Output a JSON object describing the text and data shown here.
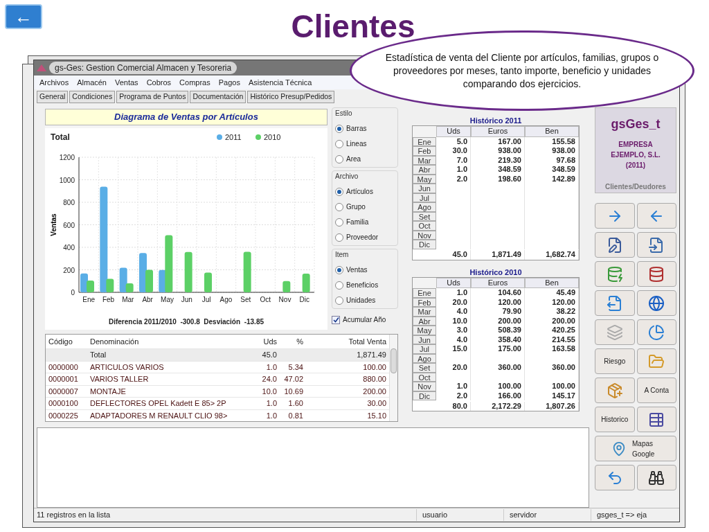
{
  "slide": {
    "back_button": "←",
    "title": "Clientes",
    "callout": "Estadística de venta del Cliente  por artículos, familias, grupos o proveedores por meses, tanto importe, beneficio y unidades comparando dos ejercicios."
  },
  "window": {
    "title": "gs-Ges: Gestion Comercial Almacen y Tesoreria"
  },
  "menu": [
    "Archivos",
    "Almacén",
    "Ventas",
    "Cobros",
    "Compras",
    "Pagos",
    "Asistencia Técnica"
  ],
  "tabs": [
    {
      "label": "General",
      "selected": false
    },
    {
      "label": "Condiciones",
      "selected": false
    },
    {
      "label": "Programa de Puntos",
      "selected": false
    },
    {
      "label": "Documentación",
      "selected": false
    },
    {
      "label": "Histórico Presup/Pedidos",
      "selected": false
    }
  ],
  "chart_panel": {
    "heading": "Diagrama de Ventas por Artículos",
    "summary": "Diferencia 2011/2010  -300.8  Desviación  -13.85",
    "chart_data": {
      "type": "bar",
      "grid": true,
      "title": "Total",
      "ylabel": "Ventas",
      "categories": [
        "Ene",
        "Feb",
        "Mar",
        "Abr",
        "May",
        "Jun",
        "Jul",
        "Ago",
        "Set",
        "Oct",
        "Nov",
        "Dic"
      ],
      "ylim": [
        0,
        1200
      ],
      "yticks": [
        0,
        200,
        400,
        600,
        800,
        1000,
        1200
      ],
      "series": [
        {
          "name": "2011",
          "color": "#5aaee6",
          "values": [
            167,
            938,
            219,
            349,
            199,
            0,
            0,
            0,
            0,
            0,
            0,
            0
          ]
        },
        {
          "name": "2010",
          "color": "#5cd066",
          "values": [
            105,
            120,
            80,
            200,
            508,
            358,
            175,
            0,
            360,
            0,
            100,
            166
          ]
        }
      ]
    }
  },
  "options": {
    "groups": [
      {
        "title": "Estilo",
        "items": [
          {
            "label": "Barras",
            "selected": true
          },
          {
            "label": "Lineas",
            "selected": false
          },
          {
            "label": "Area",
            "selected": false
          }
        ]
      },
      {
        "title": "Archivo",
        "items": [
          {
            "label": "Artículos",
            "selected": true
          },
          {
            "label": "Grupo",
            "selected": false
          },
          {
            "label": "Familia",
            "selected": false
          },
          {
            "label": "Proveedor",
            "selected": false
          }
        ]
      },
      {
        "title": "Item",
        "items": [
          {
            "label": "Ventas",
            "selected": true
          },
          {
            "label": "Beneficios",
            "selected": false
          },
          {
            "label": "Unidades",
            "selected": false
          }
        ]
      }
    ],
    "accumulate": {
      "label": "Acumular Año",
      "checked": true
    }
  },
  "history_tables": [
    {
      "title": "Histórico 2011",
      "columns": [
        "Uds",
        "Euros",
        "Ben"
      ],
      "rows": [
        {
          "month": "Ene",
          "uds": "5.0",
          "euros": "167.00",
          "ben": "155.58"
        },
        {
          "month": "Feb",
          "uds": "30.0",
          "euros": "938.00",
          "ben": "938.00"
        },
        {
          "month": "Mar",
          "uds": "7.0",
          "euros": "219.30",
          "ben": "97.68"
        },
        {
          "month": "Abr",
          "uds": "1.0",
          "euros": "348.59",
          "ben": "348.59"
        },
        {
          "month": "May",
          "uds": "2.0",
          "euros": "198.60",
          "ben": "142.89"
        },
        {
          "month": "Jun"
        },
        {
          "month": "Jul"
        },
        {
          "month": "Ago"
        },
        {
          "month": "Set"
        },
        {
          "month": "Oct"
        },
        {
          "month": "Nov"
        },
        {
          "month": "Dic"
        }
      ],
      "total": {
        "uds": "45.0",
        "euros": "1,871.49",
        "ben": "1,682.74"
      }
    },
    {
      "title": "Histórico 2010",
      "columns": [
        "Uds",
        "Euros",
        "Ben"
      ],
      "rows": [
        {
          "month": "Ene",
          "uds": "1.0",
          "euros": "104.60",
          "ben": "45.49"
        },
        {
          "month": "Feb",
          "uds": "20.0",
          "euros": "120.00",
          "ben": "120.00"
        },
        {
          "month": "Mar",
          "uds": "4.0",
          "euros": "79.90",
          "ben": "38.22"
        },
        {
          "month": "Abr",
          "uds": "10.0",
          "euros": "200.00",
          "ben": "200.00"
        },
        {
          "month": "May",
          "uds": "3.0",
          "euros": "508.39",
          "ben": "420.25"
        },
        {
          "month": "Jun",
          "uds": "4.0",
          "euros": "358.40",
          "ben": "214.55"
        },
        {
          "month": "Jul",
          "uds": "15.0",
          "euros": "175.00",
          "ben": "163.58"
        },
        {
          "month": "Ago"
        },
        {
          "month": "Set",
          "uds": "20.0",
          "euros": "360.00",
          "ben": "360.00"
        },
        {
          "month": "Oct"
        },
        {
          "month": "Nov",
          "uds": "1.0",
          "euros": "100.00",
          "ben": "100.00"
        },
        {
          "month": "Dic",
          "uds": "2.0",
          "euros": "166.00",
          "ben": "145.17"
        }
      ],
      "total": {
        "uds": "80.0",
        "euros": "2,172.29",
        "ben": "1,807.26"
      }
    }
  ],
  "articles_table": {
    "columns": [
      "Código",
      "Denominación",
      "Uds",
      "%",
      "Total Venta"
    ],
    "rows": [
      {
        "kind": "total",
        "name": "Total",
        "uds": "45.0",
        "total": "1,871.49"
      },
      {
        "kind": "item",
        "code": "0000000",
        "name": "ARTICULOS VARIOS",
        "uds": "1.0",
        "pct": "5.34",
        "total": "100.00"
      },
      {
        "kind": "item",
        "code": "0000001",
        "name": "VARIOS TALLER",
        "uds": "24.0",
        "pct": "47.02",
        "total": "880.00"
      },
      {
        "kind": "item",
        "code": "0000007",
        "name": "MONTAJE",
        "uds": "10.0",
        "pct": "10.69",
        "total": "200.00"
      },
      {
        "kind": "item",
        "code": "0000100",
        "name": "DEFLECTORES OPEL Kadett E 85> 2P",
        "uds": "1.0",
        "pct": "1.60",
        "total": "30.00"
      },
      {
        "kind": "item",
        "code": "0000225",
        "name": "ADAPTADORES M RENAULT CLIO 98>",
        "uds": "1.0",
        "pct": "0.81",
        "total": "15.10"
      }
    ]
  },
  "side_panel": {
    "logo": "gsGes_t",
    "company": "EMPRESA EJEMPLO, S.L. (2011)",
    "section": "Clientes/Deudores",
    "buttons": [
      {
        "kind": "icon"
      },
      {
        "kind": "icon"
      },
      {
        "kind": "icon"
      },
      {
        "kind": "icon"
      },
      {
        "kind": "icon"
      },
      {
        "kind": "icon"
      },
      {
        "kind": "icon"
      },
      {
        "kind": "icon"
      },
      {
        "kind": "icon"
      },
      {
        "kind": "icon"
      },
      {
        "kind": "text",
        "label": "Riesgo"
      },
      {
        "kind": "icon"
      },
      {
        "kind": "icon"
      },
      {
        "kind": "text",
        "label": "A Conta"
      },
      {
        "kind": "text",
        "label": "Historico"
      },
      {
        "kind": "icon"
      },
      {
        "kind": "wide",
        "label": "Mapas Google"
      },
      {
        "kind": "icon"
      },
      {
        "kind": "icon"
      }
    ]
  },
  "status_bar": [
    "11 registros en la lista",
    "usuario",
    "servidor",
    "gsges_t => eja"
  ]
}
